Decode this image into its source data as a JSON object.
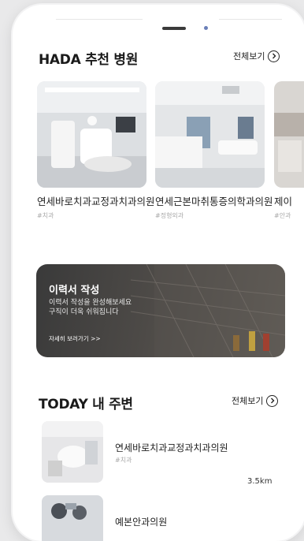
{
  "recommend": {
    "title": "HADA 추천 병원",
    "view_all": "전체보기",
    "cards": [
      {
        "name": "연세바로치과교정과치과의원",
        "tag": "#치과"
      },
      {
        "name": "연세근본마취통증의학과의원",
        "tag": "#정형외과"
      },
      {
        "name": "제이",
        "tag": "#안과"
      }
    ]
  },
  "banner": {
    "title": "이력서 작성",
    "desc_line1": "이력서 작성을 완성해보세요",
    "desc_line2": "구직이 더욱 쉬워집니다",
    "link": "자세히 보러가기 >>"
  },
  "nearby": {
    "title": "TODAY 내 주변",
    "view_all": "전체보기",
    "items": [
      {
        "name": "연세바로치과교정과치과의원",
        "tag": "#치과",
        "distance": "3.5km"
      },
      {
        "name": "예본안과의원",
        "tag": "",
        "distance": ""
      }
    ]
  },
  "icons": {
    "view_all": "chevron-right-circle-icon"
  },
  "colors": {
    "background": "#e9e9ea",
    "phone": "#ffffff",
    "text": "#1a1a1a",
    "muted": "#aaaaaa"
  }
}
